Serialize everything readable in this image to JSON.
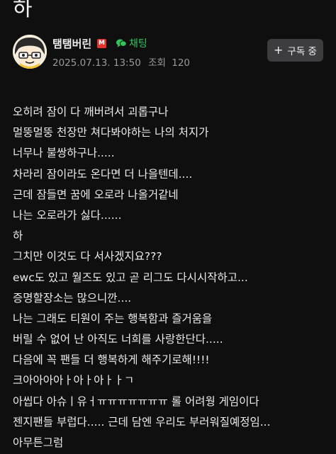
{
  "post": {
    "title": "하",
    "author": {
      "name": "탬탬버린",
      "badge": "M",
      "chat_label": "채팅",
      "avatar_icon": "cartoon-face-avatar"
    },
    "meta": {
      "date": "2025.07.13. 13:50",
      "views_label": "조회",
      "views": "120"
    },
    "subscribe_label": "구독 중",
    "subscribe_icon": "plus-icon",
    "body_lines": [
      "오히려 잠이 다 깨버려서 괴롭구나",
      "멀뚱멀뚱 천장만 쳐다봐야하는 나의 처지가",
      "너무나 불쌍하구나.....",
      "차라리 잠이라도 온다면 더 나을텐데....",
      "근데 잠들면 꿈에 오로라 나올거같네",
      "나는 오로라가 싫다......",
      "하",
      "그치만 이것도 다 서사겠지요???",
      "ewc도 있고 월즈도 있고 곧 리그도 다시시작하고...",
      "증명할장소는 많으니깐....",
      "나는 그래도 티원이 주는 행복함과 즐거움을",
      "버릴 수 없어 난 아직도 너희를 사랑한단다.....",
      "다음에 꼭 팬들 더 행복하게 해주기로해!!!!",
      "크아아아아ㅏ아ㅏ아ㅏㅏㄱ",
      "아씹다 아슈ㅣ유ㅓㅠㅠㅠㅠㅠㅠㅠ 롤 어려웡 게임이다",
      "젠지팬들 부럽다..... 근데 담엔 우리도 부러워질예정임...",
      "아무튼그럼"
    ]
  },
  "colors": {
    "background": "#0f0f10",
    "text": "#ececec",
    "meta": "#9a9a9a",
    "chat_green": "#35c35c",
    "badge_red": "#e5322d",
    "button_bg": "#3d3d3f"
  }
}
